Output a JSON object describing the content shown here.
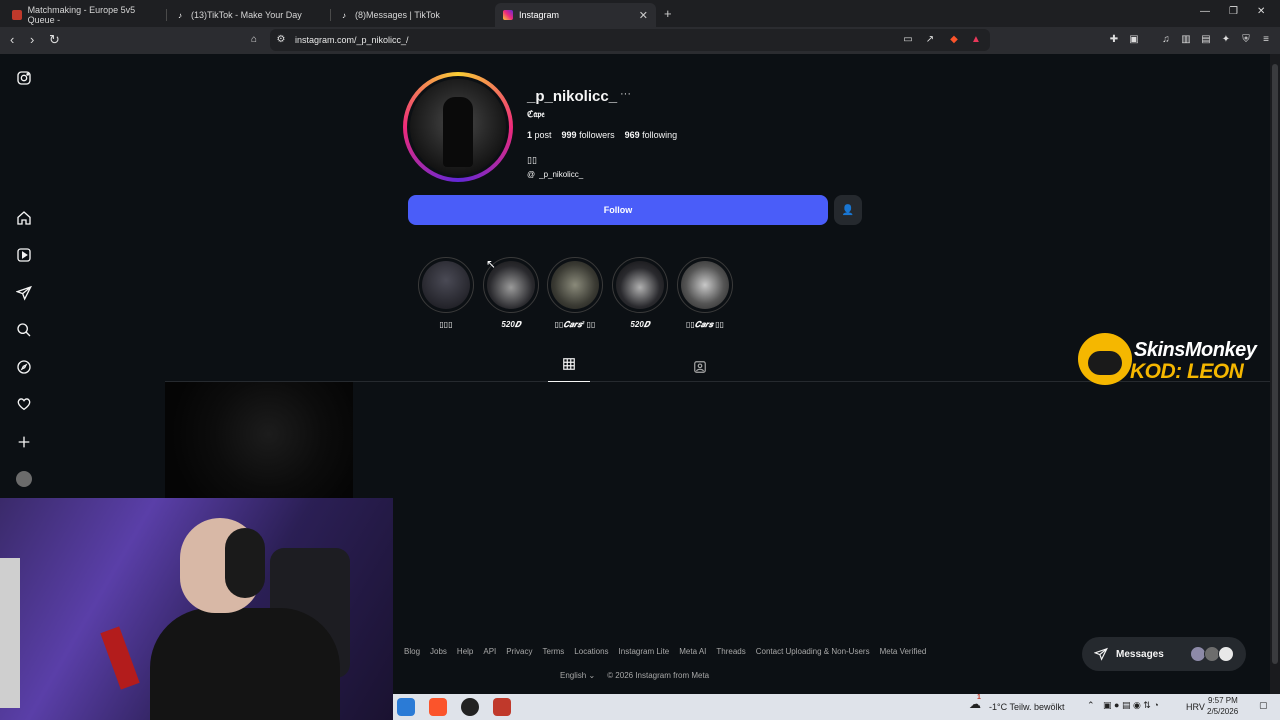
{
  "browser": {
    "tabs": [
      {
        "title": "Matchmaking - Europe 5v5 Queue -",
        "active": false
      },
      {
        "title": "(13)TikTok - Make Your Day",
        "active": false
      },
      {
        "title": "(8)Messages | TikTok",
        "active": false
      },
      {
        "title": "Instagram",
        "active": true
      }
    ],
    "close_glyph": "✕",
    "new_tab_glyph": "+",
    "url": "instagram.com/_p_nikolicc_/",
    "colors": {
      "tab_bg": "#1e1f22",
      "toolbar_bg": "#2b2c30",
      "instagram_bg": "#0c1014",
      "follow_blue": "#4a5df9"
    }
  },
  "profile": {
    "username": "_p_nikolicc_",
    "more_glyph": "···",
    "full_name": "ℭ𝔞𝔭𝔢",
    "posts_count": "1",
    "posts_label": "post",
    "followers_count": "999",
    "followers_label": "followers",
    "following_count": "969",
    "following_label": "following",
    "bio": "▯▯",
    "threads_handle": "_p_nikolicc_",
    "follow_label": "Follow"
  },
  "highlights": [
    {
      "label": "▯▯▯"
    },
    {
      "label": "520𝑫"
    },
    {
      "label": "▯▯𝑪𝒂𝒓𝒔² ▯▯"
    },
    {
      "label": "520𝑫"
    },
    {
      "label": "▯▯𝑪𝒂𝒓𝒔 ▯▯"
    }
  ],
  "footer": {
    "links": [
      "Blog",
      "Jobs",
      "Help",
      "API",
      "Privacy",
      "Terms",
      "Locations",
      "Instagram Lite",
      "Meta AI",
      "Threads",
      "Contact Uploading & Non-Users",
      "Meta Verified"
    ],
    "language": "English",
    "copyright": "© 2026 Instagram from Meta"
  },
  "messages": {
    "label": "Messages"
  },
  "overlay": {
    "line1": "SkinsMonkey",
    "line2": "KOD: LEON"
  },
  "taskbar": {
    "weather": "-1°C  Teilw. bewölkt",
    "lang": "HRV",
    "time": "9:57 PM",
    "date": "2/5/2026",
    "notification_badge": "1"
  },
  "icons": {
    "sidebar": [
      "instagram-logo-icon",
      "home-icon",
      "reels-icon",
      "direct-icon",
      "search-icon",
      "explore-icon",
      "heart-icon",
      "create-icon",
      "profile-avatar-icon"
    ]
  }
}
